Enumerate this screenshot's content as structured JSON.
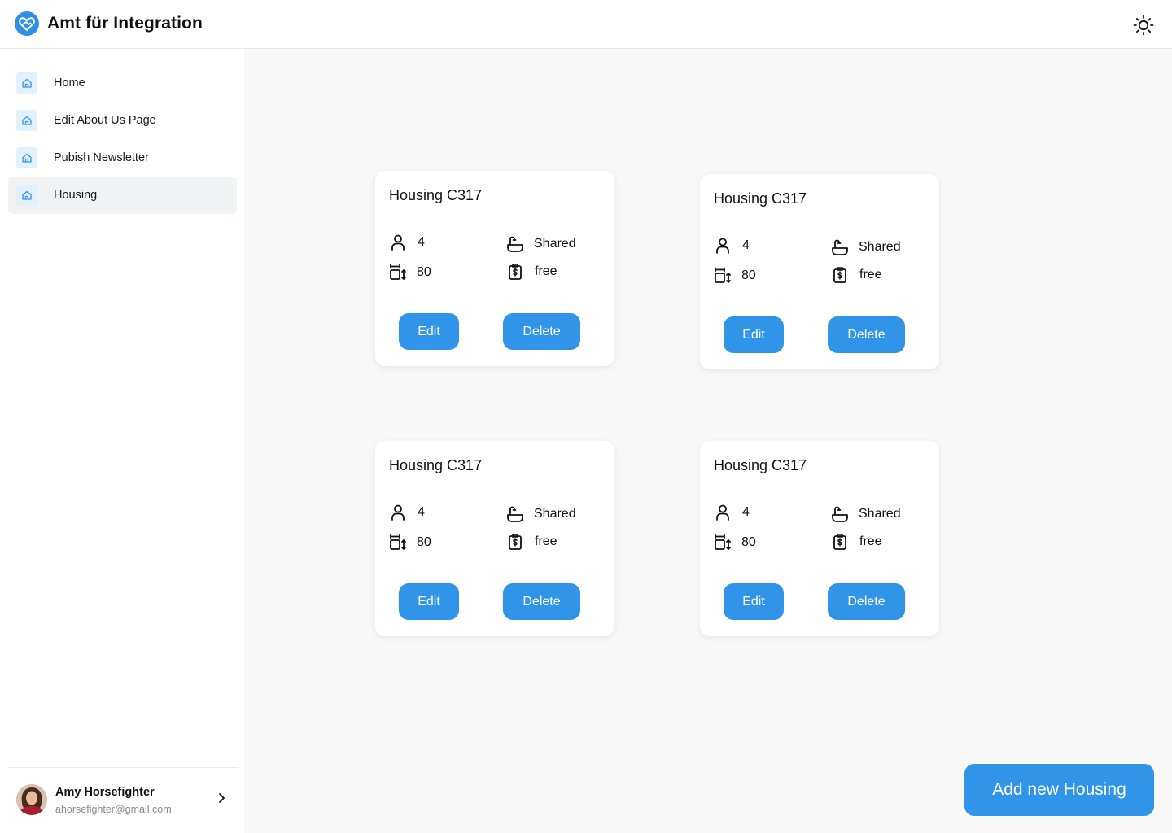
{
  "app": {
    "title": "Amt für Integration"
  },
  "header": {
    "theme_toggle_icon": "sun-icon"
  },
  "sidebar": {
    "items": [
      {
        "label": "Home",
        "icon": "home-icon",
        "active": false
      },
      {
        "label": "Edit About Us Page",
        "icon": "home-icon",
        "active": false
      },
      {
        "label": "Pubish Newsletter",
        "icon": "home-icon",
        "active": false
      },
      {
        "label": "Housing",
        "icon": "home-icon",
        "active": true
      }
    ]
  },
  "user": {
    "name": "Amy Horsefighter",
    "email": "ahorsefighter@gmail.com"
  },
  "housings": [
    {
      "title": "Housing C317",
      "occupants": "4",
      "area": "80",
      "bathroom": "Shared",
      "price": "free",
      "edit_label": "Edit",
      "delete_label": "Delete"
    },
    {
      "title": "Housing C317",
      "occupants": "4",
      "area": "80",
      "bathroom": "Shared",
      "price": "free",
      "edit_label": "Edit",
      "delete_label": "Delete"
    },
    {
      "title": "Housing C317",
      "occupants": "4",
      "area": "80",
      "bathroom": "Shared",
      "price": "free",
      "edit_label": "Edit",
      "delete_label": "Delete"
    },
    {
      "title": "Housing C317",
      "occupants": "4",
      "area": "80",
      "bathroom": "Shared",
      "price": "free",
      "edit_label": "Edit",
      "delete_label": "Delete"
    }
  ],
  "actions": {
    "add_label": "Add new Housing"
  },
  "colors": {
    "accent": "#3095e8",
    "nav_icon_bg": "#e3f1fc",
    "active_nav_bg": "#f2f3f5"
  }
}
